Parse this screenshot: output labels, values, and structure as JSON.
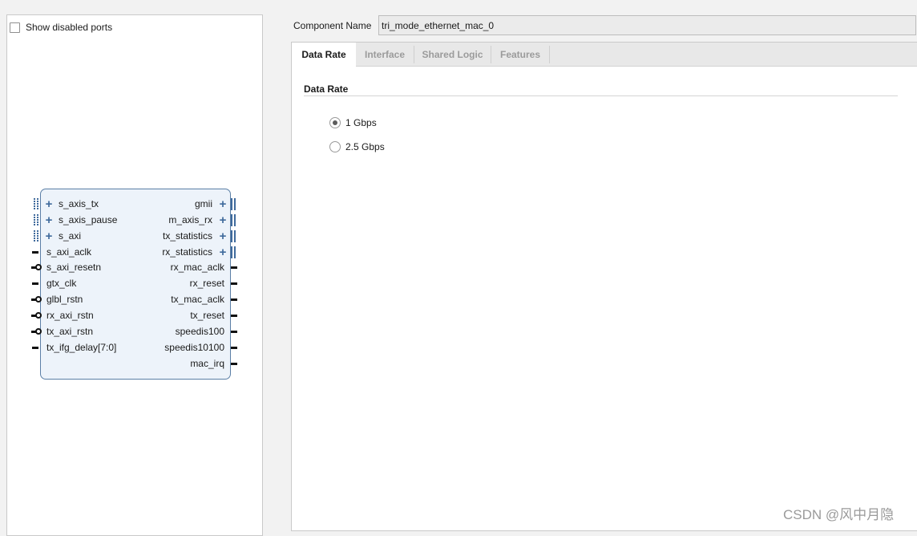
{
  "symbol_panel": {
    "show_disabled_label": "Show disabled ports",
    "show_disabled_checked": false,
    "left_ports": [
      {
        "name": "s_axis_tx",
        "kind": "bus"
      },
      {
        "name": "s_axis_pause",
        "kind": "bus"
      },
      {
        "name": "s_axi",
        "kind": "bus"
      },
      {
        "name": "s_axi_aclk",
        "kind": "clock"
      },
      {
        "name": "s_axi_resetn",
        "kind": "reset_n"
      },
      {
        "name": "gtx_clk",
        "kind": "clock"
      },
      {
        "name": "glbl_rstn",
        "kind": "reset_n"
      },
      {
        "name": "rx_axi_rstn",
        "kind": "reset_n"
      },
      {
        "name": "tx_axi_rstn",
        "kind": "reset_n"
      },
      {
        "name": "tx_ifg_delay[7:0]",
        "kind": "wire"
      }
    ],
    "right_ports": [
      {
        "name": "gmii",
        "kind": "bus"
      },
      {
        "name": "m_axis_rx",
        "kind": "bus"
      },
      {
        "name": "tx_statistics",
        "kind": "bus"
      },
      {
        "name": "rx_statistics",
        "kind": "bus"
      },
      {
        "name": "rx_mac_aclk",
        "kind": "wire"
      },
      {
        "name": "rx_reset",
        "kind": "wire"
      },
      {
        "name": "tx_mac_aclk",
        "kind": "wire"
      },
      {
        "name": "tx_reset",
        "kind": "wire"
      },
      {
        "name": "speedis100",
        "kind": "wire"
      },
      {
        "name": "speedis10100",
        "kind": "wire"
      },
      {
        "name": "mac_irq",
        "kind": "wire"
      }
    ]
  },
  "component": {
    "label": "Component Name",
    "value": "tri_mode_ethernet_mac_0"
  },
  "tabs": [
    {
      "label": "Data Rate",
      "active": true
    },
    {
      "label": "Interface",
      "active": false
    },
    {
      "label": "Shared Logic",
      "active": false
    },
    {
      "label": "Features",
      "active": false
    }
  ],
  "data_rate": {
    "section_title": "Data Rate",
    "options": [
      {
        "label": "1 Gbps",
        "selected": true
      },
      {
        "label": "2.5 Gbps",
        "selected": false
      }
    ]
  },
  "watermark": "CSDN @风中月隐",
  "colors": {
    "block_fill": "#edf3fa",
    "block_border": "#5b7fa6",
    "bus_accent": "#3f6a9c"
  }
}
